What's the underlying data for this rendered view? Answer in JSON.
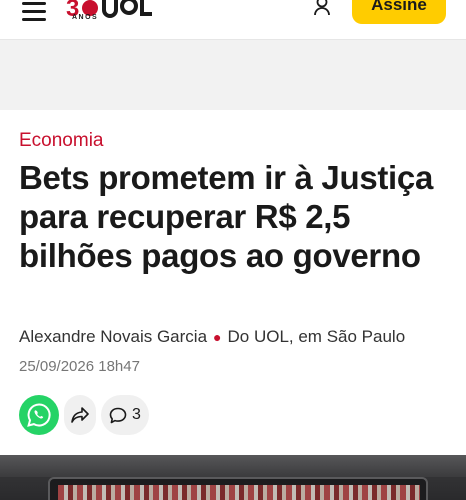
{
  "header": {
    "menu_icon": "hamburger-menu-icon",
    "logo_text": "30 ANOS",
    "logo_anos": "ANOS",
    "user_icon": "user-icon",
    "subscribe_label": "Assine",
    "subscribe_color": "#ffcc00"
  },
  "article": {
    "section": "Economia",
    "section_color": "#c8102e",
    "headline": "Bets prometem ir à Justiça para recuperar R$ 2,5 bilhões pagos ao governo",
    "author": "Alexandre Novais Garcia",
    "source": "Do UOL, em São Paulo",
    "date": "25/09/2026 18h47"
  },
  "share": {
    "whatsapp_icon": "whatsapp-icon",
    "share_icon": "share-arrow-icon",
    "comment_icon": "comment-bubble-icon",
    "comment_count": "3"
  }
}
